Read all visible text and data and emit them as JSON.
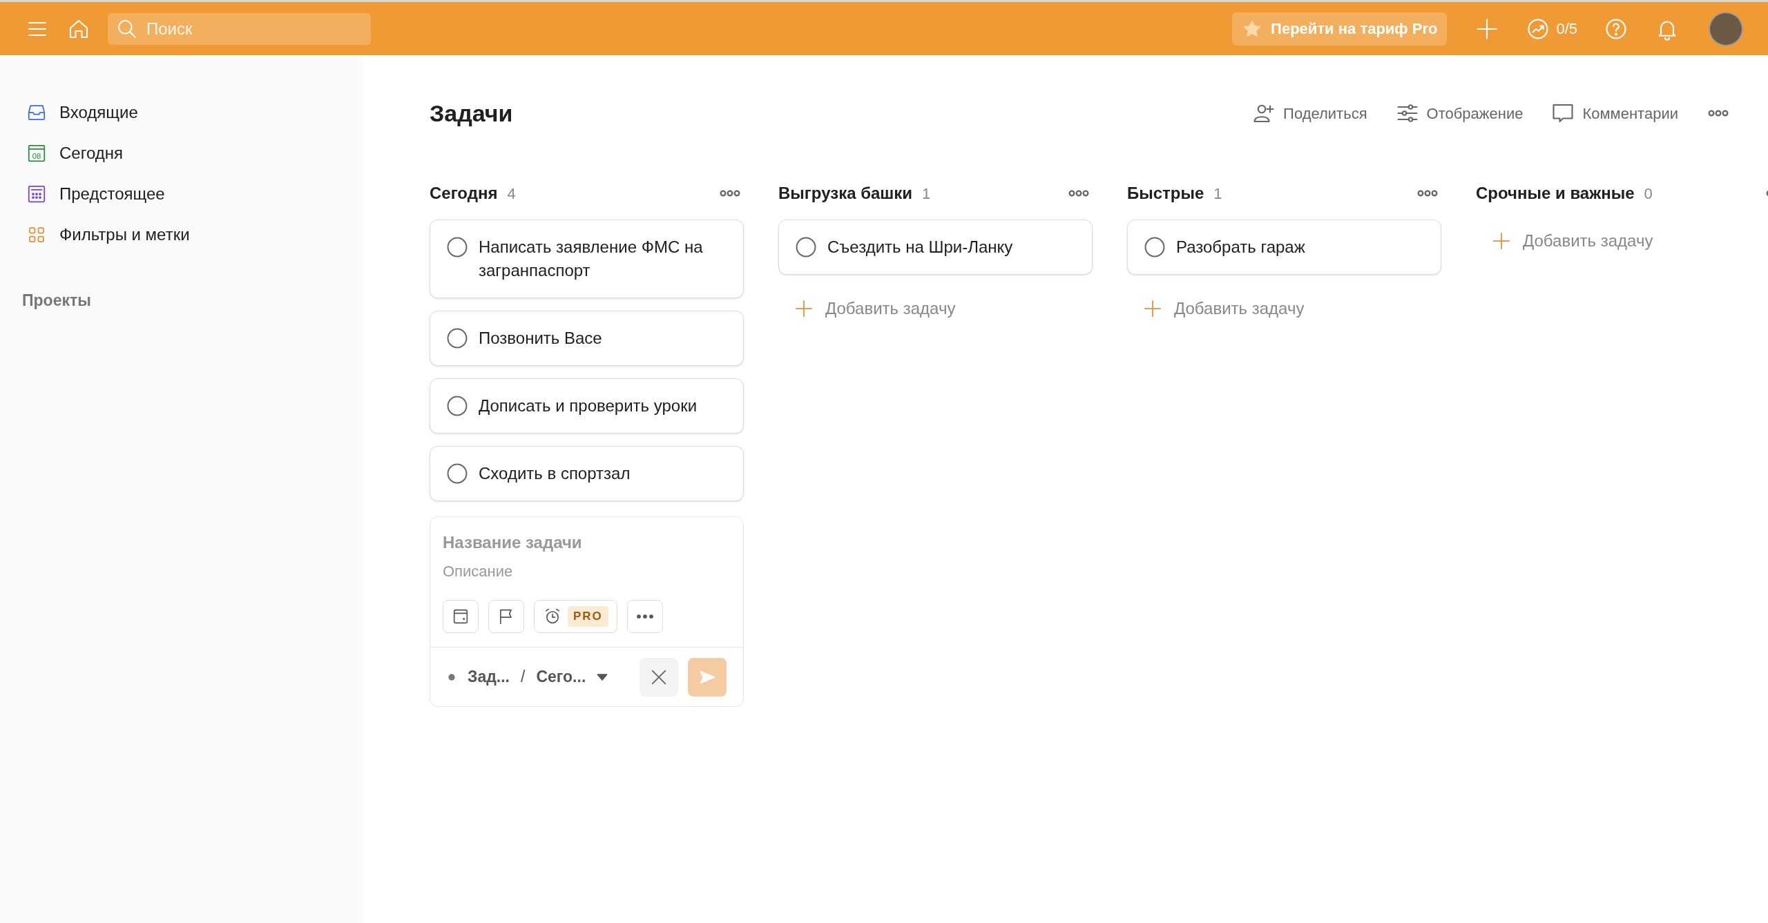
{
  "topbar": {
    "search": {
      "placeholder": "Поиск"
    },
    "upgrade_button": "Перейти на тариф Pro",
    "productivity": "0/5"
  },
  "sidebar": {
    "items": [
      {
        "kind": "inbox",
        "label": "Входящие",
        "selected": false
      },
      {
        "kind": "today",
        "label": "Сегодня",
        "selected": false,
        "icon_text": "08"
      },
      {
        "kind": "upcoming",
        "label": "Предстоящее",
        "selected": false
      },
      {
        "kind": "filters",
        "label": "Фильтры и метки",
        "selected": false
      }
    ],
    "projects_heading": "Проекты"
  },
  "header": {
    "title": "Задачи",
    "actions": [
      {
        "kind": "share",
        "label": "Поделиться"
      },
      {
        "kind": "view",
        "label": "Отображение"
      },
      {
        "kind": "comments",
        "label": "Комментарии"
      }
    ]
  },
  "columns": [
    {
      "title": "Сегодня",
      "count": "4",
      "tasks": [
        {
          "title": "Написать заявление ФМС на загранпаспорт",
          "checked": false
        },
        {
          "title": "Позвонить Васе",
          "checked": false
        },
        {
          "title": "Дописать и проверить уроки",
          "checked": false
        },
        {
          "title": "Сходить в спортзал",
          "checked": false
        }
      ],
      "composer": {
        "name_placeholder": "Название задачи",
        "description_placeholder": "Описание",
        "pro_badge": "PRO",
        "project": "Зад...",
        "separator": "/",
        "section": "Сего..."
      }
    },
    {
      "title": "Выгрузка башки",
      "count": "1",
      "tasks": [
        {
          "title": "Съездить на Шри-Ланку",
          "checked": false
        }
      ],
      "add_task": "Добавить задачу"
    },
    {
      "title": "Быстрые",
      "count": "1",
      "tasks": [
        {
          "title": "Разобрать гараж",
          "checked": false
        }
      ],
      "add_task": "Добавить задачу"
    },
    {
      "title": "Срочные и важные",
      "count": "0",
      "add_task": "Добавить задачу"
    }
  ]
}
